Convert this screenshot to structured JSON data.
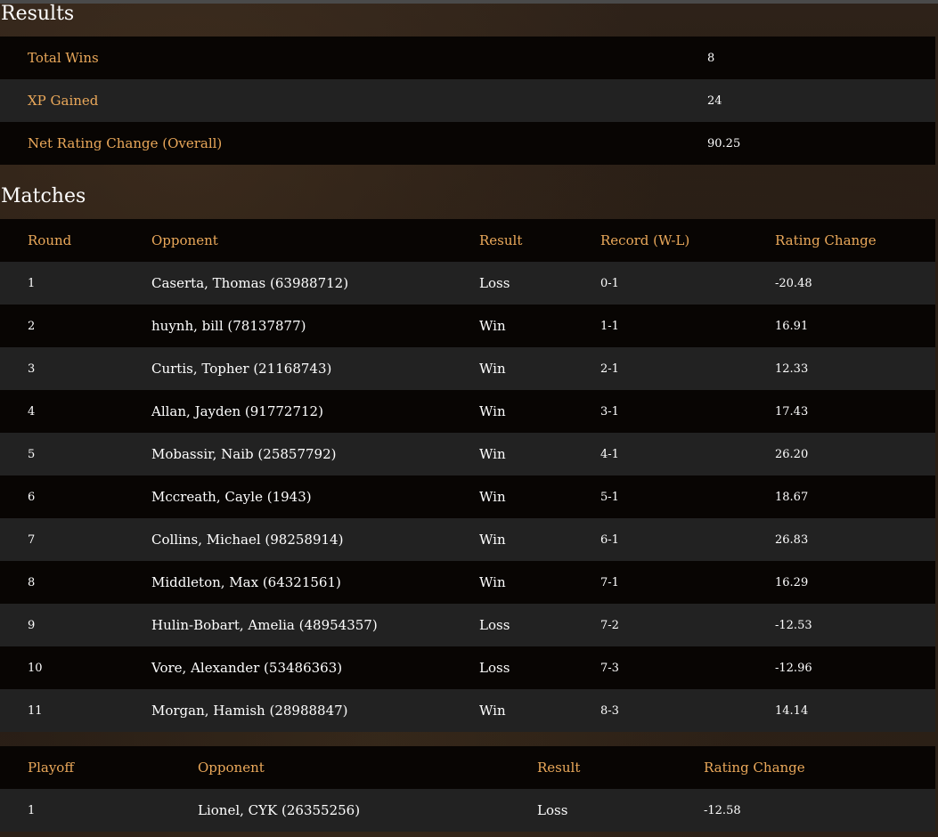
{
  "results": {
    "title": "Results",
    "rows": [
      {
        "label": "Total Wins",
        "value": "8"
      },
      {
        "label": "XP Gained",
        "value": "24"
      },
      {
        "label": "Net Rating Change (Overall)",
        "value": "90.25"
      }
    ]
  },
  "matches": {
    "title": "Matches",
    "headers": {
      "round": "Round",
      "opponent": "Opponent",
      "result": "Result",
      "record": "Record (W-L)",
      "rating_change": "Rating Change"
    },
    "rows": [
      {
        "round": "1",
        "opponent": "Caserta, Thomas (63988712)",
        "result": "Loss",
        "record": "0-1",
        "rating_change": "-20.48"
      },
      {
        "round": "2",
        "opponent": "huynh, bill (78137877)",
        "result": "Win",
        "record": "1-1",
        "rating_change": "16.91"
      },
      {
        "round": "3",
        "opponent": "Curtis, Topher (21168743)",
        "result": "Win",
        "record": "2-1",
        "rating_change": "12.33"
      },
      {
        "round": "4",
        "opponent": "Allan, Jayden (91772712)",
        "result": "Win",
        "record": "3-1",
        "rating_change": "17.43"
      },
      {
        "round": "5",
        "opponent": "Mobassir, Naib (25857792)",
        "result": "Win",
        "record": "4-1",
        "rating_change": "26.20"
      },
      {
        "round": "6",
        "opponent": "Mccreath, Cayle (1943)",
        "result": "Win",
        "record": "5-1",
        "rating_change": "18.67"
      },
      {
        "round": "7",
        "opponent": "Collins, Michael (98258914)",
        "result": "Win",
        "record": "6-1",
        "rating_change": "26.83"
      },
      {
        "round": "8",
        "opponent": "Middleton, Max (64321561)",
        "result": "Win",
        "record": "7-1",
        "rating_change": "16.29"
      },
      {
        "round": "9",
        "opponent": "Hulin-Bobart, Amelia (48954357)",
        "result": "Loss",
        "record": "7-2",
        "rating_change": "-12.53"
      },
      {
        "round": "10",
        "opponent": "Vore, Alexander (53486363)",
        "result": "Loss",
        "record": "7-3",
        "rating_change": "-12.96"
      },
      {
        "round": "11",
        "opponent": "Morgan, Hamish (28988847)",
        "result": "Win",
        "record": "8-3",
        "rating_change": "14.14"
      }
    ]
  },
  "playoffs": {
    "headers": {
      "playoff": "Playoff",
      "opponent": "Opponent",
      "result": "Result",
      "rating_change": "Rating Change"
    },
    "rows": [
      {
        "playoff": "1",
        "opponent": "Lionel, CYK (26355256)",
        "result": "Loss",
        "rating_change": "-12.58"
      }
    ]
  },
  "colors": {
    "label_accent": "#eaa85a",
    "row_dark": "#080503",
    "row_light": "#222222",
    "text": "#ffffff"
  }
}
